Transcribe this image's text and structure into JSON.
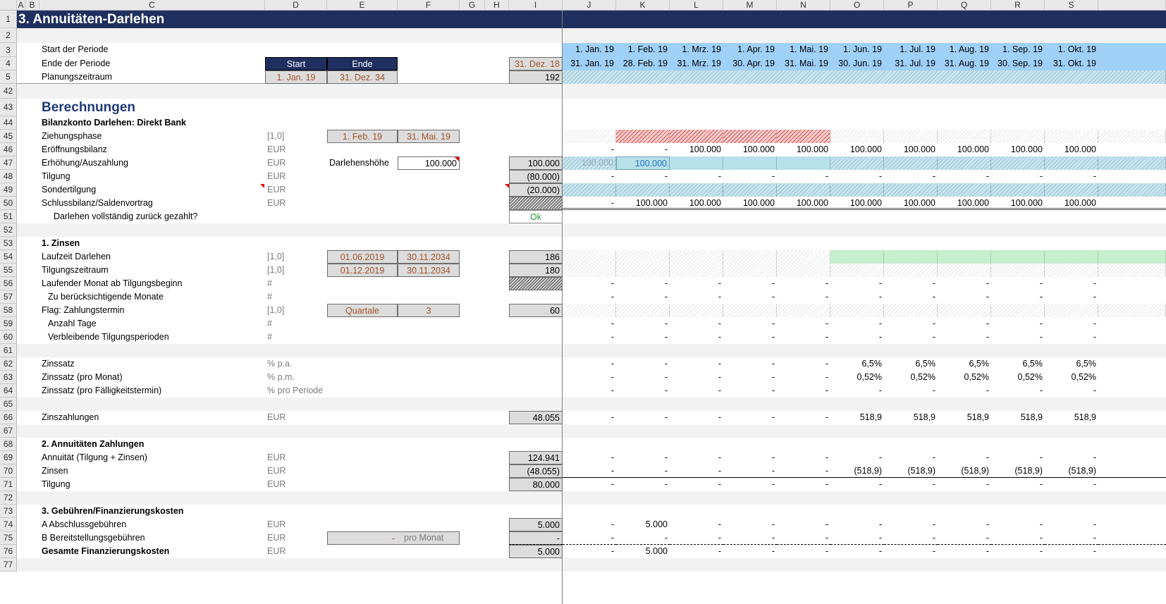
{
  "title": "3. Annuitäten-Darlehen",
  "columns": {
    "letters": [
      "A",
      "B",
      "C",
      "D",
      "E",
      "F",
      "G",
      "H",
      "I",
      "J",
      "K",
      "L",
      "M",
      "N",
      "O",
      "P",
      "Q",
      "R",
      "S"
    ]
  },
  "row_numbers": [
    "1",
    "2",
    "3",
    "4",
    "5",
    "42",
    "43",
    "44",
    "45",
    "46",
    "47",
    "48",
    "49",
    "50",
    "51",
    "52",
    "53",
    "54",
    "55",
    "56",
    "57",
    "58",
    "59",
    "60",
    "61",
    "62",
    "63",
    "64",
    "65",
    "66",
    "67",
    "68",
    "69",
    "70",
    "71",
    "72",
    "73",
    "74",
    "75",
    "76",
    "77"
  ],
  "header": {
    "start_label": "Start der Periode",
    "end_label": "Ende der Periode",
    "plan_label": "Planungszeitraum",
    "start_head": "Start",
    "end_head": "Ende",
    "plan_start": "1. Jan. 19",
    "plan_end": "31. Dez. 34",
    "prev_date": "31. Dez. 18",
    "plan_count": "192",
    "period_starts": [
      "1. Jan. 19",
      "1. Feb. 19",
      "1. Mrz. 19",
      "1. Apr. 19",
      "1. Mai. 19",
      "1. Jun. 19",
      "1. Jul. 19",
      "1. Aug. 19",
      "1. Sep. 19",
      "1. Okt. 19"
    ],
    "period_ends": [
      "31. Jan. 19",
      "28. Feb. 19",
      "31. Mrz. 19",
      "30. Apr. 19",
      "31. Mai. 19",
      "30. Jun. 19",
      "31. Jul. 19",
      "31. Aug. 19",
      "30. Sep. 19",
      "31. Okt. 19"
    ]
  },
  "section_title": "Berechnungen",
  "bilanz": {
    "title": "Bilanzkonto Darlehen: Direkt Bank",
    "rows": [
      {
        "label": "Ziehungsphase",
        "unit": "[1,0]"
      },
      {
        "label": "Eröffnungsbilanz",
        "unit": "EUR"
      },
      {
        "label": "Erhöhung/Auszahlung",
        "unit": "EUR"
      },
      {
        "label": "Tilgung",
        "unit": "EUR"
      },
      {
        "label": "Sondertilgung",
        "unit": "EUR"
      },
      {
        "label": "Schlussbilanz/Saldenvortrag",
        "unit": "EUR"
      },
      {
        "label": "Darlehen vollständig zurück gezahlt?",
        "unit": ""
      }
    ],
    "draw_start": "1. Feb. 19",
    "draw_end": "31. Mai. 19",
    "loan_label": "Darlehenshöhe",
    "loan_value": "100.000",
    "totals": {
      "increase": "100.000",
      "tilgung": "(80.000)",
      "sonder": "(20.000)",
      "check": "Ok"
    },
    "opening": [
      "-",
      "-",
      "100.000",
      "100.000",
      "100.000",
      "100.000",
      "100.000",
      "100.000",
      "100.000",
      "100.000"
    ],
    "increase_j": "100.000",
    "increase_k": "100.000",
    "tilgung_vals": [
      "-",
      "-",
      "-",
      "-",
      "-",
      "-",
      "-",
      "-",
      "-",
      "-"
    ],
    "closing": [
      "-",
      "100.000",
      "100.000",
      "100.000",
      "100.000",
      "100.000",
      "100.000",
      "100.000",
      "100.000",
      "100.000"
    ]
  },
  "zinsen": {
    "title": "1. Zinsen",
    "rows": [
      {
        "label": "Laufzeit Darlehen",
        "unit": "[1,0]",
        "e": "01.06.2019",
        "f": "30.11.2034",
        "i": "186"
      },
      {
        "label": "Tilgungszeitraum",
        "unit": "[1,0]",
        "e": "01.12.2019",
        "f": "30.11.2034",
        "i": "180"
      },
      {
        "label": "Laufender Monat ab Tilgungsbeginn",
        "unit": "#"
      },
      {
        "label": "Zu berücksichtigende Monate",
        "unit": "#"
      },
      {
        "label": "Flag: Zahlungstermin",
        "unit": "[1,0]",
        "e": "Quartale",
        "f": "3",
        "i": "60"
      },
      {
        "label": "Anzahl Tage",
        "unit": "#"
      },
      {
        "label": "Verbleibende Tilgungsperioden",
        "unit": "#"
      }
    ],
    "rate_rows": [
      {
        "label": "Zinssatz",
        "unit": "% p.a.",
        "vals": [
          "-",
          "-",
          "-",
          "-",
          "-",
          "6,5%",
          "6,5%",
          "6,5%",
          "6,5%",
          "6,5%"
        ]
      },
      {
        "label": "Zinssatz (pro Monat)",
        "unit": "% p.m.",
        "vals": [
          "-",
          "-",
          "-",
          "-",
          "-",
          "0,52%",
          "0,52%",
          "0,52%",
          "0,52%",
          "0,52%"
        ]
      },
      {
        "label": "Zinssatz (pro Fälligkeitstermin)",
        "unit": "% pro Periode",
        "vals": [
          "-",
          "-",
          "-",
          "-",
          "-",
          "-",
          "-",
          "-",
          "-",
          "-"
        ]
      }
    ],
    "payments": {
      "label": "Zinszahlungen",
      "unit": "EUR",
      "total": "48.055",
      "vals": [
        "-",
        "-",
        "-",
        "-",
        "-",
        "518,9",
        "518,9",
        "518,9",
        "518,9",
        "518,9"
      ]
    }
  },
  "annuitaet": {
    "title": "2. Annuitäten Zahlungen",
    "rows": [
      {
        "label": "Annuität (Tilgung + Zinsen)",
        "unit": "EUR",
        "total": "124.941",
        "vals": [
          "-",
          "-",
          "-",
          "-",
          "-",
          "-",
          "-",
          "-",
          "-",
          "-"
        ]
      },
      {
        "label": "Zinsen",
        "unit": "EUR",
        "total": "(48.055)",
        "vals": [
          "-",
          "-",
          "-",
          "-",
          "-",
          "(518,9)",
          "(518,9)",
          "(518,9)",
          "(518,9)",
          "(518,9)"
        ]
      },
      {
        "label": "Tilgung",
        "unit": "EUR",
        "total": "80.000",
        "vals": [
          "-",
          "-",
          "-",
          "-",
          "-",
          "-",
          "-",
          "-",
          "-",
          "-"
        ]
      }
    ]
  },
  "gebuehren": {
    "title": "3. Gebühren/Finanzierungskosten",
    "rows": [
      {
        "label": "A  Abschlussgebühren",
        "unit": "EUR",
        "total": "5.000",
        "vals": [
          "-",
          "5.000",
          "-",
          "-",
          "-",
          "-",
          "-",
          "-",
          "-",
          "-"
        ]
      },
      {
        "label": "B  Bereitstellungsgebühren",
        "unit": "EUR",
        "total": "-",
        "vals": [
          "-",
          "-",
          "-",
          "-",
          "-",
          "-",
          "-",
          "-",
          "-",
          "-"
        ],
        "e": "-",
        "note": "pro Monat"
      },
      {
        "label": "Gesamte Finanzierungskosten",
        "unit": "EUR",
        "total": "5.000",
        "vals": [
          "-",
          "5.000",
          "-",
          "-",
          "-",
          "-",
          "-",
          "-",
          "-",
          "-"
        ]
      }
    ]
  },
  "colors": {
    "title_bar": "#1f2f5f",
    "period_header": "#9fd0f8",
    "draw_phase": "#d84a4a",
    "green_flag": "#c6efce",
    "cyan": "#b7e1e8"
  }
}
